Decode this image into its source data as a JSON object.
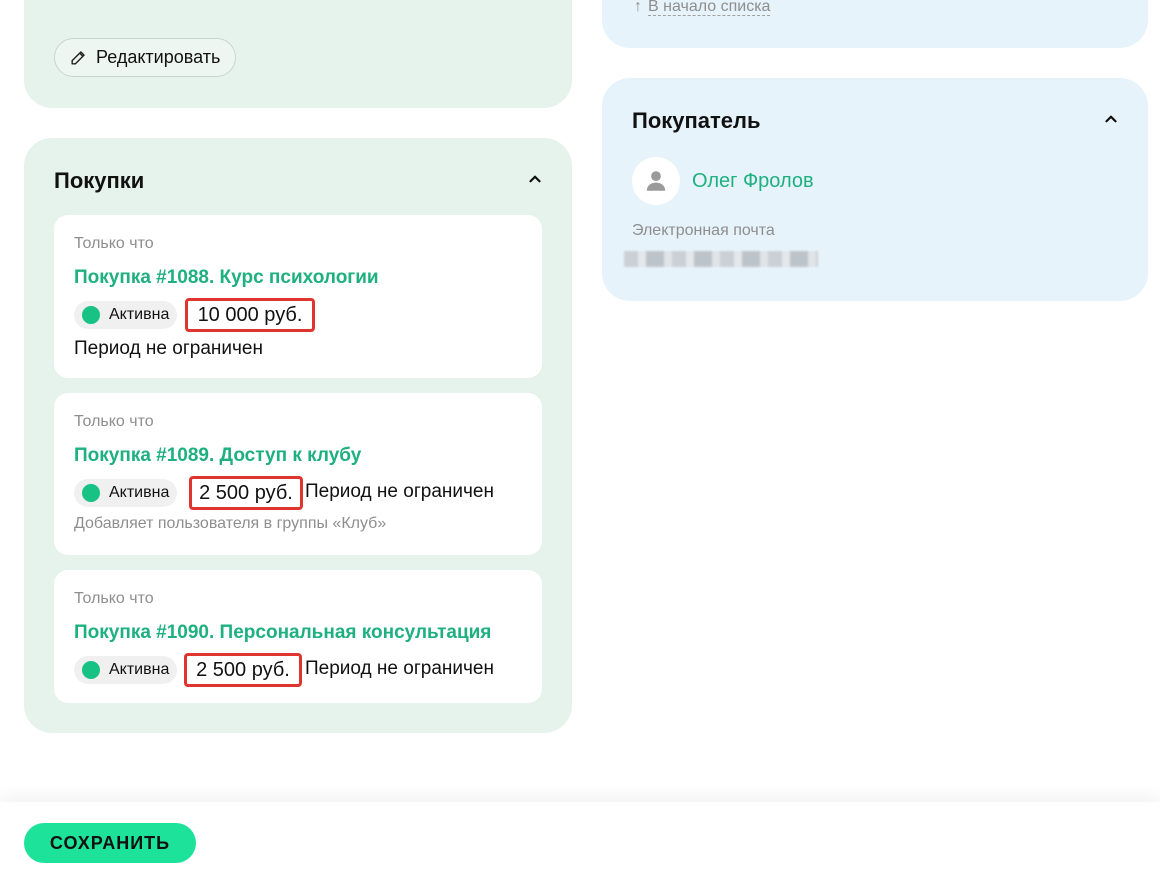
{
  "edit": {
    "label": "Редактировать",
    "icon": "pencil-icon"
  },
  "back_to_list": {
    "arrow": "↑",
    "label": "В начало списка"
  },
  "purchases": {
    "title": "Покупки",
    "items": [
      {
        "time": "Только что",
        "title": "Покупка #1088. Курс психологии",
        "status": "Активна",
        "price": "10 000 руб.",
        "period": "Период не ограничен",
        "note": ""
      },
      {
        "time": "Только что",
        "title": "Покупка #1089. Доступ к клубу",
        "status": "Активна",
        "price": "2 500 руб.",
        "period": "Период не ограничен",
        "note": "Добавляет пользователя в группы «Клуб»"
      },
      {
        "time": "Только что",
        "title": "Покупка #1090. Персональная консультация",
        "status": "Активна",
        "price": "2 500 руб.",
        "period": "Период не ограничен",
        "note": ""
      }
    ]
  },
  "buyer": {
    "title": "Покупатель",
    "name": "Олег Фролов",
    "email_label": "Электронная почта"
  },
  "footer": {
    "save_label": "СОХРАНИТЬ"
  },
  "colors": {
    "accent_green": "#1eb07f",
    "status_dot": "#18c184",
    "save_button": "#1de39a",
    "highlight_border": "#e0342f",
    "card_green": "#e5f3ec",
    "card_blue": "#e7f3fb"
  }
}
